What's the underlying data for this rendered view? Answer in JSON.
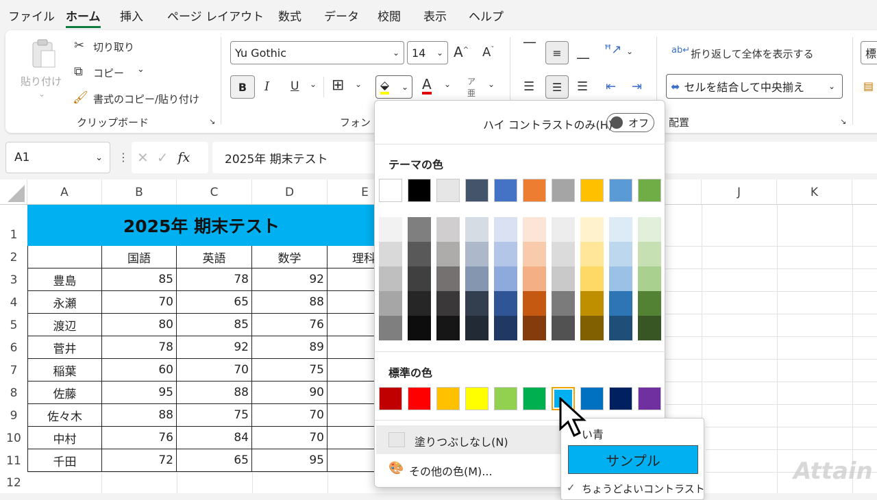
{
  "menu": {
    "tabs": [
      "ファイル",
      "ホーム",
      "挿入",
      "ページ レイアウト",
      "数式",
      "データ",
      "校閲",
      "表示",
      "ヘルプ"
    ],
    "active": "ホーム"
  },
  "clipboard": {
    "paste": "貼り付け",
    "cut": "切り取り",
    "copy": "コピー",
    "format_painter": "書式のコピー/貼り付け",
    "group_label": "クリップボード"
  },
  "font": {
    "name": "Yu Gothic",
    "size": "14",
    "bold": "B",
    "italic": "I",
    "underline": "U",
    "group_label": "フォント"
  },
  "alignment": {
    "wrap_text": "折り返して全体を表示する",
    "merge_center": "セルを結合して中央揃え",
    "group_label": "配置"
  },
  "number": {
    "format": "標"
  },
  "formula_bar": {
    "cell_ref": "A1",
    "fx": "fx",
    "content": "2025年 期末テスト"
  },
  "sheet": {
    "columns": [
      "A",
      "B",
      "C",
      "D",
      "E",
      "",
      "",
      "",
      "",
      "J",
      "K"
    ],
    "rows": [
      "1",
      "2",
      "3",
      "4",
      "5",
      "6",
      "7",
      "8",
      "9",
      "10",
      "11",
      "12"
    ],
    "title": "2025年 期末テスト",
    "title_color": "#00b0f0",
    "headers": [
      "国語",
      "英語",
      "数学",
      "理科"
    ],
    "data": [
      {
        "name": "豊島",
        "scores": [
          "85",
          "78",
          "92"
        ]
      },
      {
        "name": "永瀬",
        "scores": [
          "70",
          "65",
          "88"
        ]
      },
      {
        "name": "渡辺",
        "scores": [
          "80",
          "85",
          "76"
        ]
      },
      {
        "name": "菅井",
        "scores": [
          "78",
          "92",
          "89"
        ]
      },
      {
        "name": "稲葉",
        "scores": [
          "60",
          "70",
          "75"
        ]
      },
      {
        "name": "佐藤",
        "scores": [
          "95",
          "88",
          "90"
        ]
      },
      {
        "name": "佐々木",
        "scores": [
          "88",
          "75",
          "70"
        ]
      },
      {
        "name": "中村",
        "scores": [
          "76",
          "84",
          "70"
        ]
      },
      {
        "name": "千田",
        "scores": [
          "72",
          "65",
          "95"
        ]
      }
    ]
  },
  "fill_dropdown": {
    "high_contrast_label": "ハイ コントラストのみ(H)",
    "toggle_state": "オフ",
    "theme_title": "テーマの色",
    "theme_colors": [
      "#ffffff",
      "#000000",
      "#e7e6e6",
      "#44546a",
      "#4472c4",
      "#ed7d31",
      "#a5a5a5",
      "#ffc000",
      "#5b9bd5",
      "#70ad47"
    ],
    "theme_shades": [
      [
        "#f2f2f2",
        "#d9d9d9",
        "#bfbfbf",
        "#a6a6a6",
        "#7f7f7f"
      ],
      [
        "#7f7f7f",
        "#595959",
        "#404040",
        "#262626",
        "#0d0d0d"
      ],
      [
        "#d0cece",
        "#aeabab",
        "#757171",
        "#3a3838",
        "#171616"
      ],
      [
        "#d6dce4",
        "#adb9ca",
        "#8496b0",
        "#333f4f",
        "#222a35"
      ],
      [
        "#d9e1f2",
        "#b4c6e7",
        "#8ea9db",
        "#2f5597",
        "#1f3864"
      ],
      [
        "#fce4d6",
        "#f8cbad",
        "#f4b084",
        "#c65911",
        "#843c0c"
      ],
      [
        "#ededed",
        "#dbdbdb",
        "#c9c9c9",
        "#7b7b7b",
        "#525252"
      ],
      [
        "#fff2cc",
        "#ffe699",
        "#ffd966",
        "#bf8f00",
        "#806000"
      ],
      [
        "#ddebf7",
        "#bdd7ee",
        "#9bc2e6",
        "#2e75b6",
        "#1f4e78"
      ],
      [
        "#e2efda",
        "#c6e0b4",
        "#a9d08e",
        "#548235",
        "#375623"
      ]
    ],
    "standard_title": "標準の色",
    "standard_colors": [
      "#c00000",
      "#ff0000",
      "#ffc000",
      "#ffff00",
      "#92d050",
      "#00b050",
      "#00b0f0",
      "#0070c0",
      "#002060",
      "#7030a0"
    ],
    "no_fill": "塗りつぶしなし(N)",
    "more_colors": "その他の色(M)..."
  },
  "tooltip": {
    "color_name": "い青",
    "sample": "サンプル",
    "contrast": "ちょうどよいコントラスト"
  },
  "watermark": "Attain"
}
